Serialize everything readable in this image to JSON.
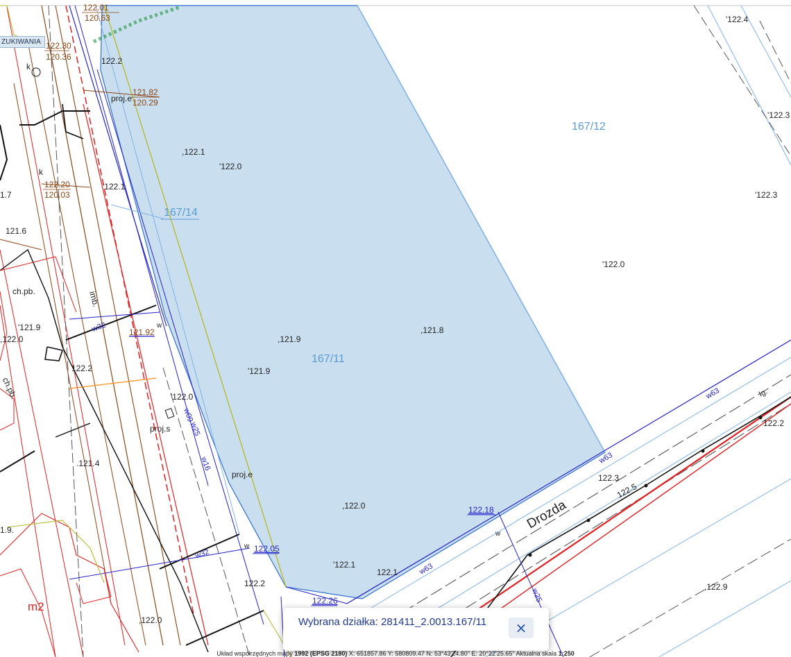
{
  "search_panel": {
    "tab_label": "ZUKIWANIA"
  },
  "selection": {
    "label": "Wybrana działka:",
    "parcel_id": "281411_2.0013.167/11",
    "text": "Wybrana działka: 281411_2.0013.167/11",
    "close_icon": "close-icon"
  },
  "status_bar": {
    "crs_label": "Układ współrzędnych mapy",
    "crs_value": "1992 (EPSG 2180)",
    "x_label": "X:",
    "x_value": "651857.86",
    "y_label": "Y:",
    "y_value": "580809.47",
    "n_label": "N:",
    "n_value": "53°43'24.80\"",
    "e_label": "E:",
    "e_value": "20°22'25.65\"",
    "scale_label": "Aktualna skala",
    "scale_value": "1:250"
  },
  "map": {
    "colors": {
      "parcel_fill": "#c9deee",
      "parcel_border": "#2f6fd0",
      "parcel_label": "#5b9bd5",
      "height_label": "#222222",
      "utility_red": "#e02020",
      "boundary_brown": "#8b4513"
    },
    "parcels": [
      "167/11",
      "167/12",
      "167/14"
    ],
    "street": "Drozda",
    "building_label": "m2",
    "height_points": [
      "122.4",
      "122.3",
      "122.3",
      "122.2",
      "122.1",
      "122.0",
      "122.1",
      "121.6",
      "121.9",
      "122.0",
      "121.9",
      "121.9",
      "121.8",
      "122.0",
      "122.0",
      "121.4",
      "122.0",
      "122.1",
      "122.1",
      "122.2",
      "122.0",
      "122.3",
      "122.5",
      "122.9",
      "122.2",
      "1.7",
      "1.9",
      "122.2"
    ],
    "elevations_fraction": [
      [
        "121.82",
        "120.29"
      ],
      [
        "122.20",
        "120.03"
      ],
      [
        "122.01",
        "120.63"
      ],
      [
        "122.30",
        "120.36"
      ]
    ],
    "underlined_heights": [
      "122.18",
      "122.05",
      "122.26",
      "121.92"
    ],
    "annotations": [
      "proj.e",
      "proj.e",
      "proj.s",
      "ch.pb.",
      "ch.pb.",
      "imb.",
      "k",
      "k",
      "w",
      "w",
      "w",
      "Ig."
    ],
    "utility_codes": [
      "w63",
      "w63",
      "w63",
      "w32",
      "w25",
      "w16",
      "w25",
      "w09",
      "k",
      "t8"
    ]
  }
}
